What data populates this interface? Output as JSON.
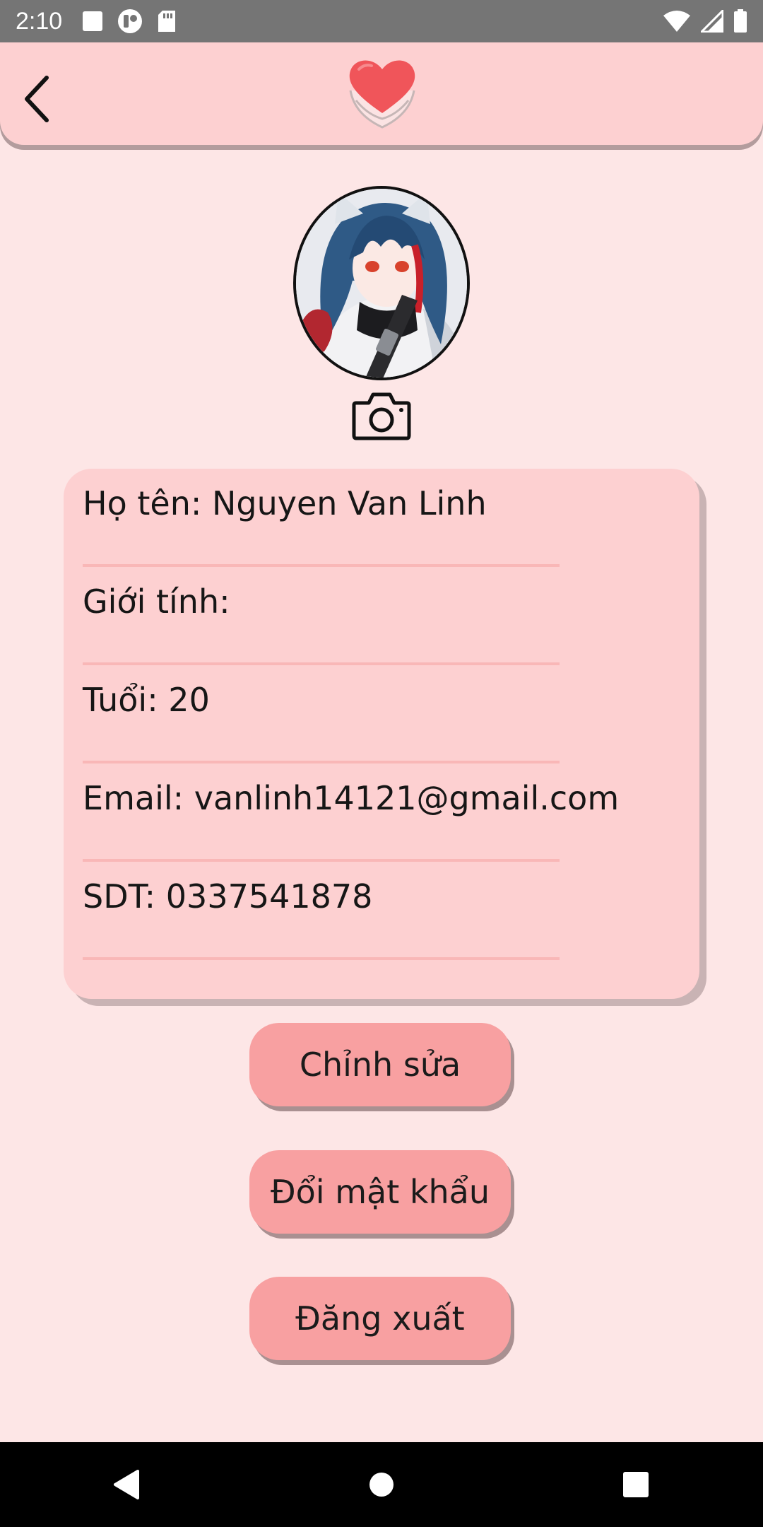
{
  "status_bar": {
    "time": "2:10",
    "left_icons": [
      "square-notification-icon",
      "app-notification-icon",
      "sd-card-icon"
    ],
    "right_icons": [
      "wifi-icon",
      "signal-icon",
      "battery-icon"
    ]
  },
  "header": {
    "back_icon": "chevron-left-icon",
    "logo_icon": "heart-in-hands-icon"
  },
  "profile": {
    "avatar_icon": "profile-avatar",
    "camera_icon": "camera-icon"
  },
  "info": {
    "name": "Họ tên: Nguyen Van Linh",
    "gender": "Giới tính:",
    "age": "Tuổi: 20",
    "email": "Email: vanlinh14121@gmail.com",
    "phone": "SDT: 0337541878"
  },
  "buttons": {
    "edit": "Chỉnh sửa",
    "change_password": "Đổi mật khẩu",
    "logout": "Đăng xuất"
  },
  "colors": {
    "background": "#fde6e6",
    "header": "#fdd0d1",
    "card": "#fdd0d1",
    "button": "#f8a0a1",
    "divider": "#f9b7b7",
    "heart": "#f0555a"
  },
  "nav_bar": {
    "icons": [
      "back-triangle-icon",
      "home-circle-icon",
      "recents-square-icon"
    ]
  }
}
